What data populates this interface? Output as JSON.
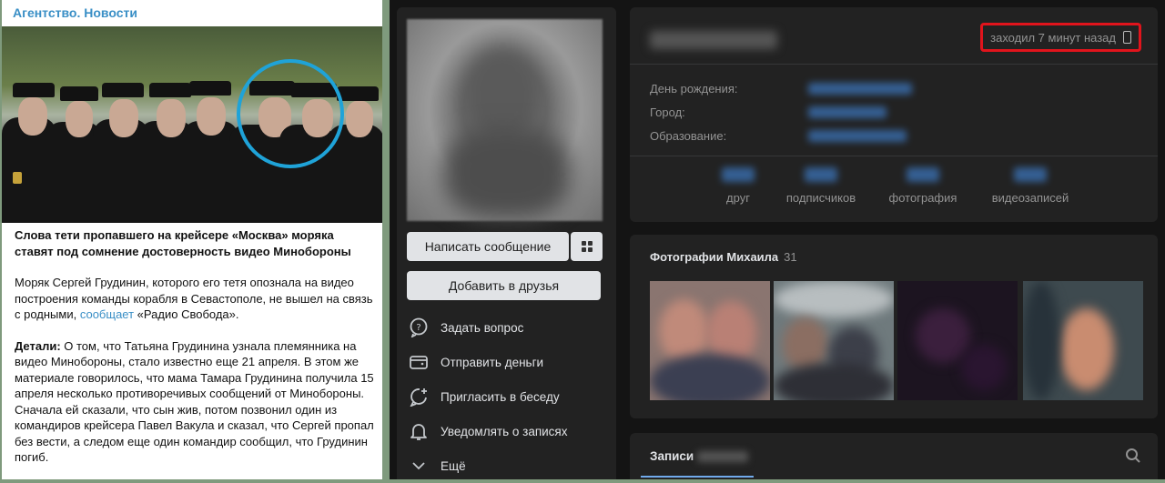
{
  "news": {
    "channel": "Агентство. Новости",
    "headline": "Слова тети пропавшего на крейсере «Москва» моряка ставят под сомнение достоверность видео Минобороны",
    "p1_before": "Моряк Сергей Грудинин, которого его тетя опознала на видео построения команды корабля в Севастополе, не вышел на связь с родными, ",
    "p1_link": "сообщает",
    "p1_after": " «Радио Свобода».",
    "p2_label": "Детали:",
    "p2_text": " О том, что Татьяна Грудинина узнала племянника на видео Минобороны, стало известно еще 21 апреля. В этом же материале говорилось, что мама Тамара Грудинина получила 15 апреля несколько противоречивых сообщений от Минобороны. Сначала ей сказали, что сын жив, потом позвонил один из командиров крейсера Павел Вакула и сказал, что Сергей пропал без вести, а следом еще один командир сообщил, что Грудинин погиб."
  },
  "profile": {
    "last_seen": "заходил 7 минут назад",
    "last_seen_icon": "mobile-phone-icon",
    "info_labels": {
      "birthday": "День рождения:",
      "city": "Город:",
      "education": "Образование:"
    },
    "counters": [
      "друг",
      "подписчиков",
      "фотография",
      "видеозаписей"
    ],
    "buttons": {
      "message": "Написать сообщение",
      "add_friend": "Добавить в друзья"
    },
    "menu": [
      {
        "label": "Задать вопрос",
        "icon": "question-bubble-icon"
      },
      {
        "label": "Отправить деньги",
        "icon": "wallet-icon"
      },
      {
        "label": "Пригласить в беседу",
        "icon": "chat-add-icon"
      },
      {
        "label": "Уведомлять о записях",
        "icon": "bell-icon"
      },
      {
        "label": "Ещё",
        "icon": "chevron-down-icon"
      }
    ],
    "photos": {
      "title": "Фотографии Михаила",
      "count": "31"
    },
    "posts_tab": "Записи"
  },
  "colors": {
    "link": "#3a8fc6",
    "vk_bg": "#141414",
    "vk_card": "#222222",
    "highlight_red": "#e1141c",
    "circle_blue": "#1fa3d8"
  }
}
